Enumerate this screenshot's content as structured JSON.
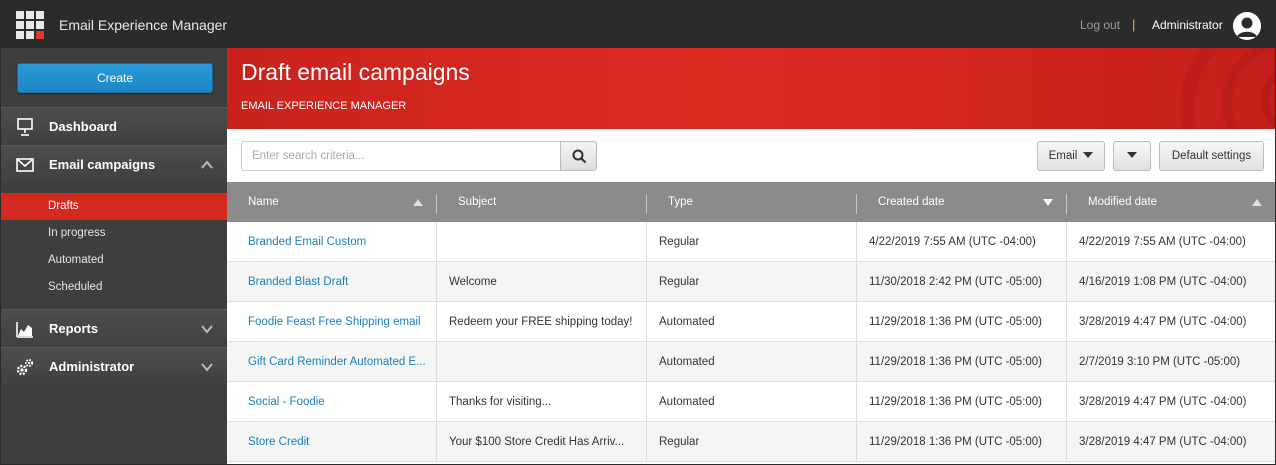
{
  "topbar": {
    "app_title": "Email Experience Manager",
    "logout_label": "Log out",
    "separator": "|",
    "user_name": "Administrator"
  },
  "sidebar": {
    "create_label": "Create",
    "items": [
      {
        "label": "Dashboard",
        "icon": "presentation-board-icon"
      },
      {
        "label": "Email campaigns",
        "icon": "envelope-icon",
        "expanded": true
      },
      {
        "label": "Reports",
        "icon": "chart-icon",
        "expanded": false
      },
      {
        "label": "Administrator",
        "icon": "gears-icon",
        "expanded": false
      }
    ],
    "subitems": [
      "Drafts",
      "In progress",
      "Automated",
      "Scheduled"
    ],
    "active_subitem": "Drafts"
  },
  "banner": {
    "title": "Draft email campaigns",
    "subtitle": "EMAIL EXPERIENCE MANAGER"
  },
  "toolbar": {
    "search_placeholder": "Enter search criteria...",
    "search_value": "",
    "email_filter_label": "Email",
    "default_settings_label": "Default settings"
  },
  "table": {
    "columns": [
      "Name",
      "Subject",
      "Type",
      "Created date",
      "Modified date"
    ],
    "rows": [
      {
        "name": "Branded Email Custom",
        "subject": "",
        "type": "Regular",
        "created": "4/22/2019 7:55 AM (UTC -04:00)",
        "modified": "4/22/2019 7:55 AM (UTC -04:00)"
      },
      {
        "name": "Branded Blast Draft",
        "subject": "Welcome",
        "type": "Regular",
        "created": "11/30/2018 2:42 PM (UTC -05:00)",
        "modified": "4/16/2019 1:08 PM (UTC -04:00)"
      },
      {
        "name": "Foodie Feast Free Shipping email",
        "subject": "Redeem your FREE shipping today!",
        "type": "Automated",
        "created": "11/29/2018 1:36 PM (UTC -05:00)",
        "modified": "3/28/2019 4:47 PM (UTC -04:00)"
      },
      {
        "name": "Gift Card Reminder Automated E...",
        "subject": "",
        "type": "Automated",
        "created": "11/29/2018 1:36 PM (UTC -05:00)",
        "modified": "2/7/2019 3:10 PM (UTC -05:00)"
      },
      {
        "name": "Social - Foodie",
        "subject": "Thanks for visiting...",
        "type": "Automated",
        "created": "11/29/2018 1:36 PM (UTC -05:00)",
        "modified": "3/28/2019 4:47 PM (UTC -04:00)"
      },
      {
        "name": "Store Credit",
        "subject": "Your $100 Store Credit Has Arriv...",
        "type": "Regular",
        "created": "11/29/2018 1:36 PM (UTC -05:00)",
        "modified": "3/28/2019 4:47 PM (UTC -04:00)"
      }
    ]
  },
  "colors": {
    "accent_red": "#d42a20",
    "create_blue": "#1c86c4",
    "link_blue": "#1b7fb9",
    "topbar_dark": "#2b2b2b"
  }
}
